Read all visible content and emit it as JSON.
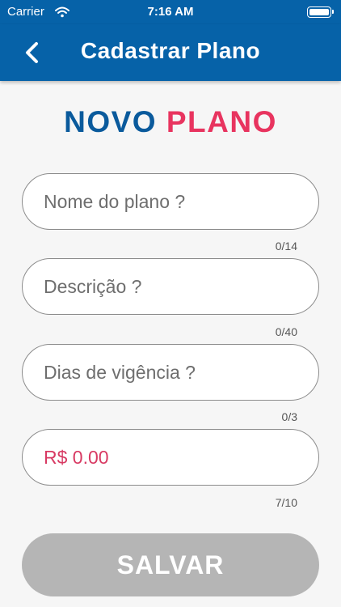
{
  "status_bar": {
    "carrier": "Carrier",
    "time": "7:16 AM"
  },
  "nav": {
    "title": "Cadastrar Plano"
  },
  "heading": {
    "part1": "NOVO",
    "part2": "PLANO"
  },
  "form": {
    "name": {
      "placeholder": "Nome do plano ?",
      "value": "",
      "counter": "0/14"
    },
    "description": {
      "placeholder": "Descrição ?",
      "value": "",
      "counter": "0/40"
    },
    "days": {
      "placeholder": "Dias de vigência ?",
      "value": "",
      "counter": "0/3"
    },
    "price": {
      "placeholder": "",
      "value": "R$ 0.00",
      "counter": "7/10"
    }
  },
  "save_button": {
    "label": "SALVAR"
  },
  "colors": {
    "primary": "#0662a8",
    "accent": "#e8345f",
    "disabled_button": "#b5b5b5"
  },
  "icons": [
    "wifi-icon",
    "battery-icon",
    "chevron-left-icon"
  ]
}
